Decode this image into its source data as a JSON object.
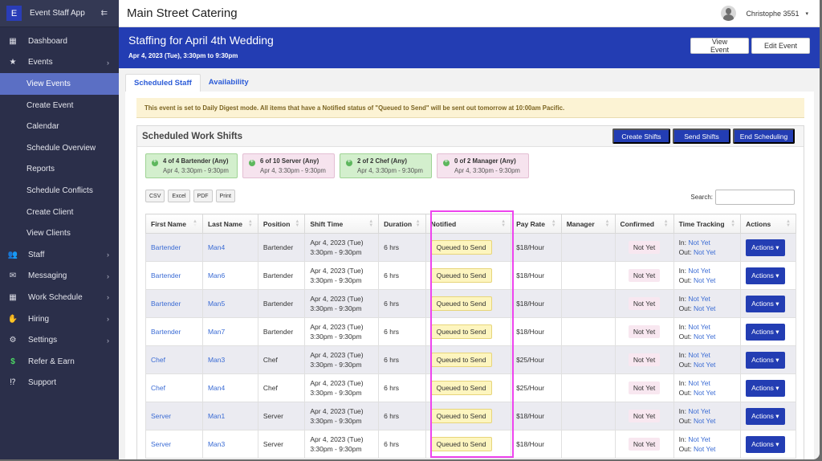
{
  "sidebar": {
    "logo_letter": "E",
    "app_name": "Event Staff App",
    "collapse_icon": "collapse-menu-icon",
    "items": [
      {
        "label": "Dashboard",
        "icon": "dashboard-icon",
        "glyph": "▦",
        "chevron": false
      },
      {
        "label": "Events",
        "icon": "star-icon",
        "glyph": "★",
        "chevron": true
      },
      {
        "label": "View Events",
        "sub": true,
        "active": true
      },
      {
        "label": "Create Event",
        "sub": true
      },
      {
        "label": "Calendar",
        "sub": true
      },
      {
        "label": "Schedule Overview",
        "sub": true
      },
      {
        "label": "Reports",
        "sub": true
      },
      {
        "label": "Schedule Conflicts",
        "sub": true
      },
      {
        "label": "Create Client",
        "sub": true
      },
      {
        "label": "View Clients",
        "sub": true
      },
      {
        "label": "Staff",
        "icon": "users-icon",
        "glyph": "👥",
        "chevron": true
      },
      {
        "label": "Messaging",
        "icon": "envelope-icon",
        "glyph": "✉",
        "chevron": true
      },
      {
        "label": "Work Schedule",
        "icon": "calendar-icon",
        "glyph": "▦",
        "chevron": true
      },
      {
        "label": "Hiring",
        "icon": "hand-icon",
        "glyph": "✋",
        "chevron": true
      },
      {
        "label": "Settings",
        "icon": "gear-icon",
        "glyph": "⚙",
        "chevron": true
      },
      {
        "label": "Refer & Earn",
        "icon": "dollar-icon",
        "glyph": "$",
        "chevron": false
      },
      {
        "label": "Support",
        "icon": "support-icon",
        "glyph": "⁉",
        "chevron": false
      }
    ]
  },
  "topbar": {
    "org_name": "Main Street Catering",
    "user_name": "Christophe 3551",
    "user_caret": "▾"
  },
  "banner": {
    "title": "Staffing for April 4th Wedding",
    "subtitle": "Apr 4, 2023 (Tue), 3:30pm to 9:30pm",
    "view_event": "View Event",
    "edit_event": "Edit Event"
  },
  "tabs": [
    {
      "label": "Scheduled Staff",
      "active": true
    },
    {
      "label": "Availability",
      "active": false
    }
  ],
  "alert": "This event is set to Daily Digest mode. All items that have a Notified status of \"Queued to Send\" will be sent out tomorrow at 10:00am Pacific.",
  "panel": {
    "title": "Scheduled Work Shifts",
    "buttons": [
      "Create Shifts",
      "Send Shifts",
      "End Scheduling"
    ],
    "cards": [
      {
        "title": "4 of 4 Bartender (Any)",
        "time": "Apr 4, 3:30pm - 9:30pm",
        "status": "green"
      },
      {
        "title": "6 of 10 Server (Any)",
        "time": "Apr 4, 3:30pm - 9:30pm",
        "status": "pink"
      },
      {
        "title": "2 of 2 Chef (Any)",
        "time": "Apr 4, 3:30pm - 9:30pm",
        "status": "green"
      },
      {
        "title": "0 of 2 Manager (Any)",
        "time": "Apr 4, 3:30pm - 9:30pm",
        "status": "pink"
      }
    ],
    "exports": [
      "CSV",
      "Excel",
      "PDF",
      "Print"
    ],
    "search_label": "Search:",
    "search_value": ""
  },
  "table": {
    "headers": [
      "First Name",
      "Last Name",
      "Position",
      "Shift Time",
      "Duration",
      "Notified",
      "Pay Rate",
      "Manager",
      "Confirmed",
      "Time Tracking",
      "Actions"
    ],
    "rows": [
      {
        "first": "Bartender",
        "last": "Man4",
        "position": "Bartender",
        "date": "Apr 4, 2023 (Tue)",
        "time": "3:30pm - 9:30pm",
        "duration": "6 hrs",
        "notified": "Queued to Send",
        "pay": "$18/Hour",
        "manager": "",
        "confirmed": "Not Yet",
        "in_label": "In:",
        "in_val": "Not Yet",
        "out_label": "Out:",
        "out_val": "Not Yet",
        "action": "Actions ▾"
      },
      {
        "first": "Bartender",
        "last": "Man6",
        "position": "Bartender",
        "date": "Apr 4, 2023 (Tue)",
        "time": "3:30pm - 9:30pm",
        "duration": "6 hrs",
        "notified": "Queued to Send",
        "pay": "$18/Hour",
        "manager": "",
        "confirmed": "Not Yet",
        "in_label": "In:",
        "in_val": "Not Yet",
        "out_label": "Out:",
        "out_val": "Not Yet",
        "action": "Actions ▾"
      },
      {
        "first": "Bartender",
        "last": "Man5",
        "position": "Bartender",
        "date": "Apr 4, 2023 (Tue)",
        "time": "3:30pm - 9:30pm",
        "duration": "6 hrs",
        "notified": "Queued to Send",
        "pay": "$18/Hour",
        "manager": "",
        "confirmed": "Not Yet",
        "in_label": "In:",
        "in_val": "Not Yet",
        "out_label": "Out:",
        "out_val": "Not Yet",
        "action": "Actions ▾"
      },
      {
        "first": "Bartender",
        "last": "Man7",
        "position": "Bartender",
        "date": "Apr 4, 2023 (Tue)",
        "time": "3:30pm - 9:30pm",
        "duration": "6 hrs",
        "notified": "Queued to Send",
        "pay": "$18/Hour",
        "manager": "",
        "confirmed": "Not Yet",
        "in_label": "In:",
        "in_val": "Not Yet",
        "out_label": "Out:",
        "out_val": "Not Yet",
        "action": "Actions ▾"
      },
      {
        "first": "Chef",
        "last": "Man3",
        "position": "Chef",
        "date": "Apr 4, 2023 (Tue)",
        "time": "3:30pm - 9:30pm",
        "duration": "6 hrs",
        "notified": "Queued to Send",
        "pay": "$25/Hour",
        "manager": "",
        "confirmed": "Not Yet",
        "in_label": "In:",
        "in_val": "Not Yet",
        "out_label": "Out:",
        "out_val": "Not Yet",
        "action": "Actions ▾"
      },
      {
        "first": "Chef",
        "last": "Man4",
        "position": "Chef",
        "date": "Apr 4, 2023 (Tue)",
        "time": "3:30pm - 9:30pm",
        "duration": "6 hrs",
        "notified": "Queued to Send",
        "pay": "$25/Hour",
        "manager": "",
        "confirmed": "Not Yet",
        "in_label": "In:",
        "in_val": "Not Yet",
        "out_label": "Out:",
        "out_val": "Not Yet",
        "action": "Actions ▾"
      },
      {
        "first": "Server",
        "last": "Man1",
        "position": "Server",
        "date": "Apr 4, 2023 (Tue)",
        "time": "3:30pm - 9:30pm",
        "duration": "6 hrs",
        "notified": "Queued to Send",
        "pay": "$18/Hour",
        "manager": "",
        "confirmed": "Not Yet",
        "in_label": "In:",
        "in_val": "Not Yet",
        "out_label": "Out:",
        "out_val": "Not Yet",
        "action": "Actions ▾"
      },
      {
        "first": "Server",
        "last": "Man3",
        "position": "Server",
        "date": "Apr 4, 2023 (Tue)",
        "time": "3:30pm - 9:30pm",
        "duration": "6 hrs",
        "notified": "Queued to Send",
        "pay": "$18/Hour",
        "manager": "",
        "confirmed": "Not Yet",
        "in_label": "In:",
        "in_val": "Not Yet",
        "out_label": "Out:",
        "out_val": "Not Yet",
        "action": "Actions ▾"
      }
    ]
  },
  "colors": {
    "brand_blue": "#233db3",
    "sidebar_bg": "#2b2f4a",
    "sidebar_active": "#5b6fc4",
    "highlight": "#ee44ee",
    "queued_bg": "#fdf5bf",
    "link": "#3a6bd4"
  }
}
